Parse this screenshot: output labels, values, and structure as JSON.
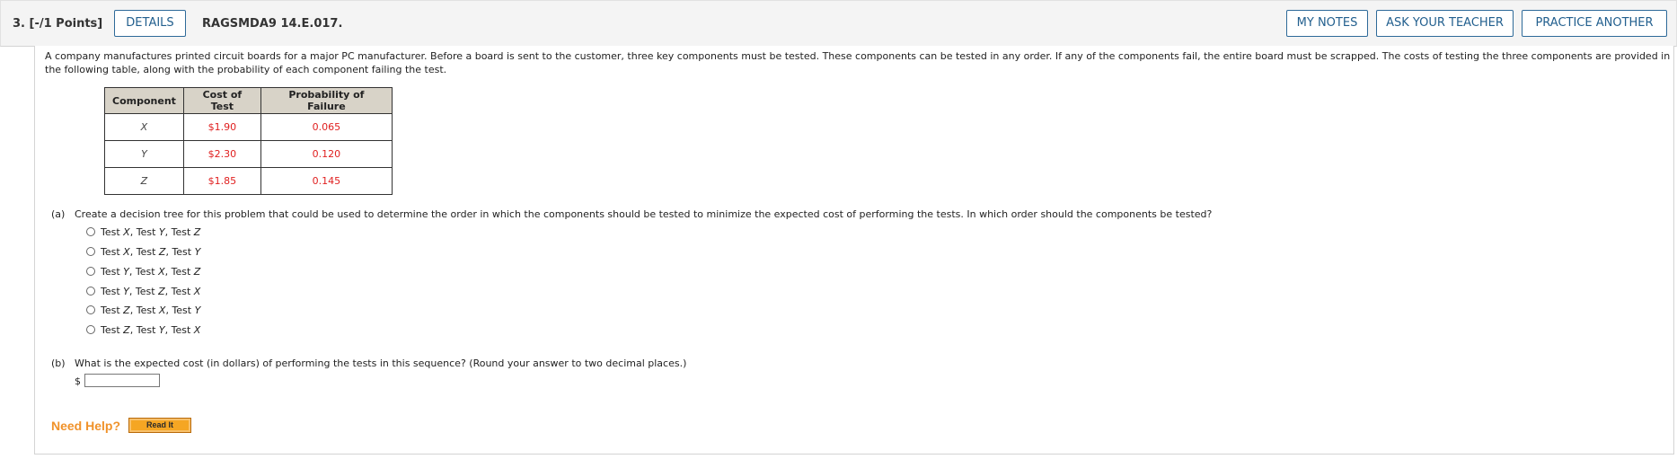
{
  "header": {
    "question_label": "3.  [-/1 Points]",
    "details_label": "DETAILS",
    "problem_code": "RAGSMDA9 14.E.017.",
    "my_notes_label": "MY NOTES",
    "ask_teacher_label": "ASK YOUR TEACHER",
    "practice_label": "PRACTICE ANOTHER"
  },
  "intro_text": "A company manufactures printed circuit boards for a major PC manufacturer. Before a board is sent to the customer, three key components must be tested. These components can be tested in any order. If any of the components fail, the entire board must be scrapped. The costs of testing the three components are provided in the following table, along with the probability of each component failing the test.",
  "table": {
    "headers": [
      "Component",
      "Cost of Test",
      "Probability of Failure"
    ],
    "rows": [
      {
        "component": "X",
        "cost": "$1.90",
        "probability": "0.065"
      },
      {
        "component": "Y",
        "cost": "$2.30",
        "probability": "0.120"
      },
      {
        "component": "Z",
        "cost": "$1.85",
        "probability": "0.145"
      }
    ]
  },
  "part_a": {
    "tag": "(a)",
    "question": "Create a decision tree for this problem that could be used to determine the order in which the components should be tested to minimize the expected cost of performing the tests. In which order should the components be tested?",
    "options": [
      {
        "a": "X",
        "b": "Y",
        "c": "Z"
      },
      {
        "a": "X",
        "b": "Z",
        "c": "Y"
      },
      {
        "a": "Y",
        "b": "X",
        "c": "Z"
      },
      {
        "a": "Y",
        "b": "Z",
        "c": "X"
      },
      {
        "a": "Z",
        "b": "X",
        "c": "Y"
      },
      {
        "a": "Z",
        "b": "Y",
        "c": "X"
      }
    ],
    "test_word": "Test"
  },
  "part_b": {
    "tag": "(b)",
    "question": "What is the expected cost (in dollars) of performing the tests in this sequence? (Round your answer to two decimal places.)",
    "currency_symbol": "$",
    "answer_value": ""
  },
  "help": {
    "need_help_label": "Need Help?",
    "read_it_label": "Read It"
  },
  "colors": {
    "accent_blue": "#225f8e",
    "value_red": "#e02020",
    "help_orange": "#f0922a",
    "table_header_bg": "#d8d3c8"
  }
}
